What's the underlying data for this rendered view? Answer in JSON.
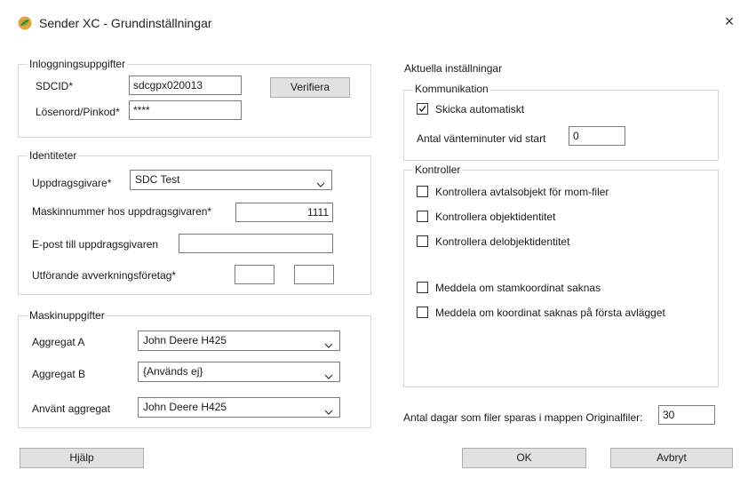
{
  "window": {
    "title": "Sender XC - Grundinställningar",
    "close_glyph": "×"
  },
  "login": {
    "legend": "Inloggningsuppgifter",
    "sdcid_label": "SDCID*",
    "sdcid_value": "sdcgpx020013",
    "password_label": "Lösenord/Pinkod*",
    "password_value": "****",
    "verify_button": "Verifiera"
  },
  "identity": {
    "legend": "Identiteter",
    "client_label": "Uppdragsgivare*",
    "client_value": "SDC Test",
    "machine_no_label": "Maskinnummer hos uppdragsgivaren*",
    "machine_no_value": "1111",
    "email_label": "E-post till uppdragsgivaren",
    "email_value": "",
    "harvester_label": "Utförande avverkningsföretag*",
    "harvester_value_1": "",
    "harvester_value_2": ""
  },
  "machine": {
    "legend": "Maskinuppgifter",
    "unit_a_label": "Aggregat A",
    "unit_a_value": "John Deere H425",
    "unit_b_label": "Aggregat B",
    "unit_b_value": "{Används ej}",
    "used_unit_label": "Använt aggregat",
    "used_unit_value": "John Deere H425"
  },
  "current": {
    "legend": "Aktuella inställningar",
    "communication": {
      "legend": "Kommunikation",
      "send_auto_label": "Skicka automatiskt",
      "send_auto_checked": true,
      "wait_minutes_label": "Antal vänteminuter vid start",
      "wait_minutes_value": "0"
    },
    "controls": {
      "legend": "Kontroller",
      "items": [
        {
          "label": "Kontrollera avtalsobjekt för mom-filer",
          "checked": false
        },
        {
          "label": "Kontrollera objektidentitet",
          "checked": false
        },
        {
          "label": "Kontrollera delobjektidentitet",
          "checked": false
        },
        {
          "label": "Meddela om stamkoordinat saknas",
          "checked": false
        },
        {
          "label": "Meddela om koordinat saknas på första avlägget",
          "checked": false
        }
      ]
    },
    "days_label": "Antal dagar som filer sparas i mappen Originalfiler:",
    "days_value": "30"
  },
  "footer": {
    "help_button": "Hjälp",
    "ok_button": "OK",
    "cancel_button": "Avbryt"
  },
  "icons": {
    "app": "sender-xc-logo-icon",
    "close": "close-icon",
    "dropdown": "chevron-down-icon",
    "check": "checkmark-icon"
  }
}
